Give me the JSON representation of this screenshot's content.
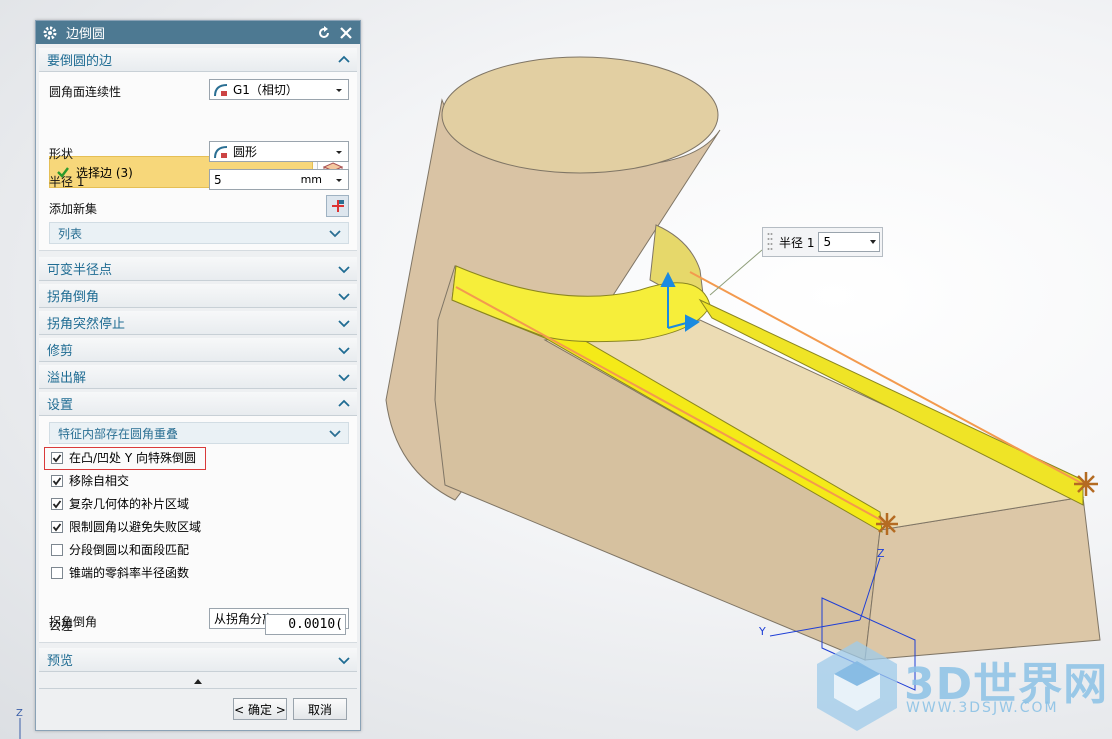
{
  "dialog": {
    "title": "边倒圆",
    "sections": {
      "edges": {
        "title": "要倒圆的边",
        "continuity_label": "圆角面连续性",
        "continuity_value": "G1（相切）",
        "select_edge_label": "选择边 (3)",
        "shape_label": "形状",
        "shape_value": "圆形",
        "radius_label": "半径 1",
        "radius_value": "5",
        "radius_unit": "mm",
        "add_new_set_label": "添加新集",
        "list_label": "列表"
      },
      "variable_radius": "可变半径点",
      "corner_setback": "拐角倒角",
      "corner_stop": "拐角突然停止",
      "trim": "修剪",
      "overflow": "溢出解",
      "settings": {
        "title": "设置",
        "sub_label": "特征内部存在圆角重叠",
        "options": [
          {
            "label": "在凸/凹处 Y 向特殊倒圆",
            "checked": true
          },
          {
            "label": "移除自相交",
            "checked": true
          },
          {
            "label": "复杂几何体的补片区域",
            "checked": true
          },
          {
            "label": "限制圆角以避免失败区域",
            "checked": true
          },
          {
            "label": "分段倒圆以和面段匹配",
            "checked": false
          },
          {
            "label": "锥端的零斜率半径函数",
            "checked": false
          }
        ],
        "corner_chamfer_label": "拐角倒角",
        "corner_chamfer_value": "从拐角分离",
        "tolerance_label": "公差",
        "tolerance_value": "0.0010("
      },
      "preview": "预览"
    },
    "buttons": {
      "ok": "< 确定 >",
      "cancel": "取消"
    }
  },
  "viewport": {
    "callout_label": "半径 1",
    "callout_value": "5",
    "triad_z": "Z",
    "triad_y": "Y",
    "corner_triad_z": "Z",
    "watermark_big": "3D世界网",
    "watermark_small": "WWW.3DSJW.COM"
  },
  "colors": {
    "title_bar": "#4d7992",
    "section_text": "#1f6c93",
    "selected_row": "#f7d77a",
    "body_tan": "#e3cfae",
    "fillet_yellow": "#f4ea18",
    "edge_orange": "#f39a4e"
  }
}
